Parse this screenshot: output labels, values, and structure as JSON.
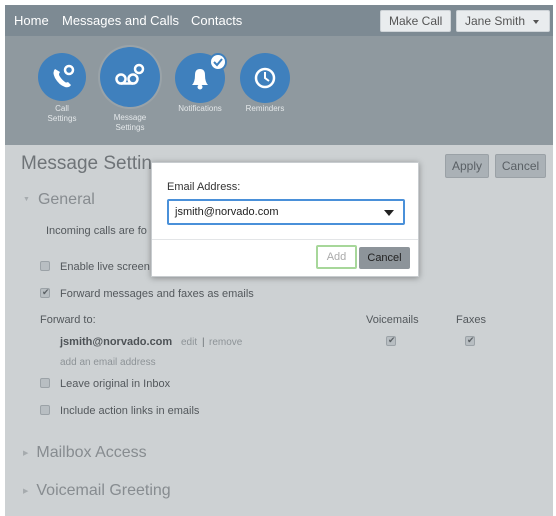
{
  "nav": {
    "home": "Home",
    "messages_calls": "Messages and Calls",
    "contacts": "Contacts",
    "make_call": "Make Call",
    "user_name": "Jane Smith"
  },
  "icon_tabs": [
    {
      "label_1": "Call",
      "label_2": "Settings",
      "icon": "phone-gear-icon"
    },
    {
      "label_1": "Message",
      "label_2": "Settings",
      "icon": "voicemail-gear-icon",
      "selected": true
    },
    {
      "label_1": "Notifications",
      "label_2": "",
      "icon": "bell-check-icon"
    },
    {
      "label_1": "Reminders",
      "label_2": "",
      "icon": "clock-icon"
    }
  ],
  "page": {
    "title": "Message Settin",
    "apply": "Apply",
    "cancel": "Cancel"
  },
  "general": {
    "heading": "General",
    "incoming_text": "Incoming calls are fo",
    "live_screen": "Enable live screen",
    "forward_label": "Forward messages and faxes as emails",
    "forward_checked": true,
    "forward_to": "Forward to:",
    "col_voicemails": "Voicemails",
    "col_faxes": "Faxes",
    "email": "jsmith@norvado.com",
    "edit": "edit",
    "sep": "|",
    "remove": "remove",
    "add_email": "add an email address",
    "leave_original": "Leave original in Inbox",
    "action_links": "Include action links in emails"
  },
  "sections": {
    "mailbox": "Mailbox Access",
    "voicemail": "Voicemail Greeting"
  },
  "modal": {
    "label": "Email Address:",
    "value": "jsmith@norvado.com",
    "add": "Add",
    "cancel": "Cancel"
  },
  "colors": {
    "accent_blue": "#3f80bd",
    "focus_blue": "#4a90d9",
    "focus_green": "#a7d79a"
  }
}
